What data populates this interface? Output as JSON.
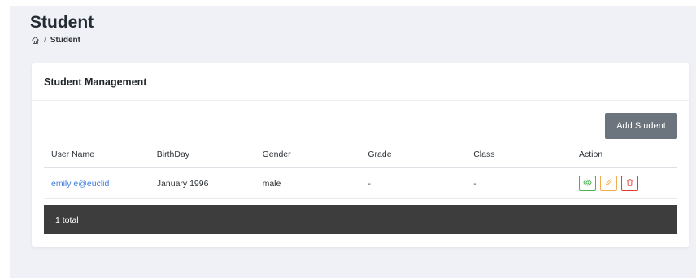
{
  "page": {
    "title": "Student"
  },
  "breadcrumb": {
    "home_icon": "home-icon",
    "separator": "/",
    "current": "Student"
  },
  "card": {
    "title": "Student Management",
    "add_button": "Add Student"
  },
  "table": {
    "headers": [
      "User Name",
      "BirthDay",
      "Gender",
      "Grade",
      "Class",
      "Action"
    ],
    "rows": [
      {
        "user_name": "emily e@euclid",
        "birthday": "January 1996",
        "gender": "male",
        "grade": "-",
        "class": "-"
      }
    ],
    "actions": {
      "view_icon": "eye-icon",
      "edit_icon": "pencil-icon",
      "delete_icon": "trash-icon"
    },
    "footer": "1 total"
  },
  "colors": {
    "link": "#3b7bdc",
    "view": "#4caf50",
    "edit": "#f0ad4e",
    "delete": "#e53935",
    "footer_bg": "#3d3d3d",
    "button_bg": "#6c757d"
  }
}
